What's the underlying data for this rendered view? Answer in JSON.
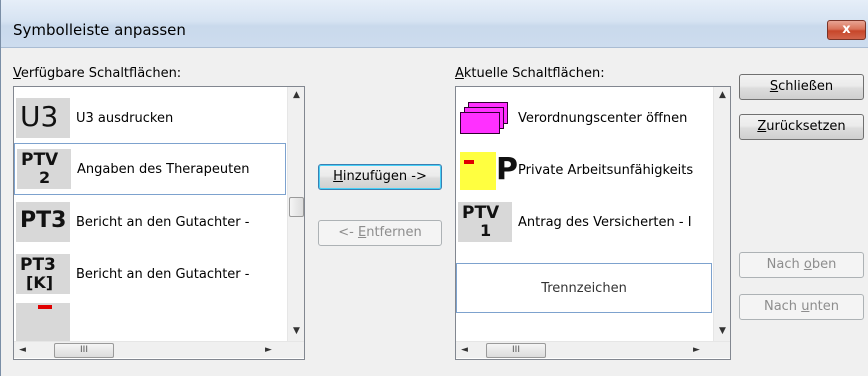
{
  "dialog": {
    "title": "Symbolleiste anpassen",
    "close_glyph": "x"
  },
  "available": {
    "label": "Verfügbare Schaltflächen:",
    "label_accel": "V",
    "label_rest": "erfügbare Schaltflächen:",
    "items": [
      {
        "icon": "u3-icon",
        "icon_text": "U3",
        "label": "U3 ausdrucken"
      },
      {
        "icon": "ptv2-icon",
        "icon_line1": "PTV",
        "icon_line2": "2",
        "label": "Angaben des Therapeuten"
      },
      {
        "icon": "pt3-icon",
        "icon_text": "PT3",
        "label": "Bericht an den Gutachter -"
      },
      {
        "icon": "pt3k-icon",
        "icon_line1": "PT3",
        "icon_line2": "[K]",
        "label": "Bericht an den Gutachter -"
      }
    ]
  },
  "current": {
    "label": "Aktuelle Schaltflächen:",
    "label_accel": "A",
    "label_rest": "ktuelle Schaltflächen:",
    "items": [
      {
        "icon": "prescription-center-icon",
        "label": "Verordnungscenter öffnen"
      },
      {
        "icon": "private-au-icon",
        "icon_text": "P",
        "label": "Private Arbeitsunfähigkeits"
      },
      {
        "icon": "ptv1-icon",
        "icon_line1": "PTV",
        "icon_line2": "1",
        "label": "Antrag des Versicherten - I"
      },
      {
        "icon": "",
        "label": "Trennzeichen"
      }
    ]
  },
  "buttons": {
    "add": {
      "pre": "",
      "accel": "H",
      "post": "inzufügen ->"
    },
    "remove": {
      "pre": "<- ",
      "accel": "E",
      "post": "ntfernen"
    },
    "close": {
      "pre": "",
      "accel": "S",
      "post": "chließen"
    },
    "reset": {
      "pre": "",
      "accel": "Z",
      "post": "urücksetzen"
    },
    "up": {
      "pre": "Nach ",
      "accel": "o",
      "post": "ben"
    },
    "down": {
      "pre": "Nach ",
      "accel": "u",
      "post": "nten"
    }
  },
  "scroll_glyphs": {
    "up": "▲",
    "down": "▼",
    "left": "◄",
    "right": "►",
    "grip": "III"
  },
  "colors": {
    "title_close": "#c7462a",
    "selection_border": "#7da2ce"
  }
}
